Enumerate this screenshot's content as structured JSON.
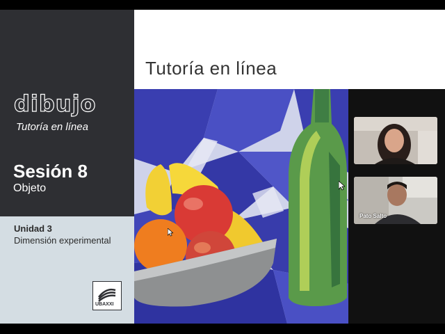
{
  "header": {
    "title": "Tutoría en línea"
  },
  "sidebar": {
    "logo_word": "dibujo",
    "logo_subtitle": "Tutoría en línea",
    "session_title": "Sesión 8",
    "session_subtitle": "Objeto",
    "unit_title": "Unidad 3",
    "unit_subtitle": "Dimensión experimental",
    "institution_logo_text": "UBAXXI"
  },
  "participants": [
    {
      "name": ""
    },
    {
      "name": "Pato Salto"
    }
  ],
  "colors": {
    "sidebar_dark": "#2e2f33",
    "sidebar_light": "#d4dde3",
    "painting_blue": "#3b3fb5"
  },
  "icons": [
    "mouse-cursor-icon",
    "uba-logo-icon"
  ]
}
